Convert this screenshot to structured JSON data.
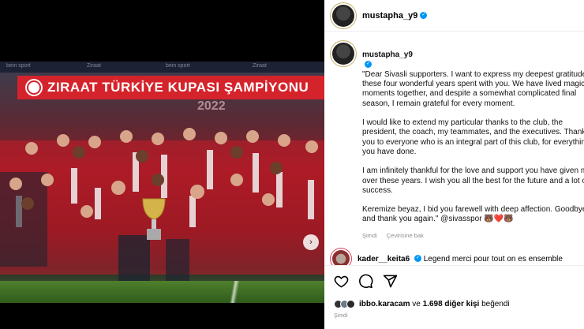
{
  "post": {
    "username": "mustapha_y9",
    "banner_text": "ZIRAAT TÜRKİYE KUPASI ŞAMPİYONU",
    "banner_year": "2022",
    "ad_strip": [
      "bein sport",
      "Ziraat",
      "bein sport",
      "Ziraat"
    ],
    "caption_paragraphs": [
      "\"Dear Sivasli supporters. I want to express my deepest gratitude for these four wonderful years spent with you. We have lived magical moments together, and despite a somewhat complicated final season, I remain grateful for every moment.",
      "I would like to extend my particular thanks to the club, the president, the coach, my teammates, and the executives. Thank you to everyone who is an integral part of this club, for everything you have done.",
      "I am infinitely thankful for the love and support you have given me over these years. I wish you all the best for the future and a lot of success.",
      "Keremize beyaz, I bid you farewell with deep affection. Goodbye and thank you again.\" @sivasspor 🐻❤️🐻"
    ],
    "caption_time": "Şimdi",
    "translate_label": "Çevirisine bak"
  },
  "comment": {
    "username": "kader__keita6",
    "text": "Legend merci pour tout on es ensemble"
  },
  "likes": {
    "user": "ibbo.karacam",
    "connector": "ve",
    "others": "1.698 diğer kişi",
    "suffix": "beğendi",
    "time": "Şimdi"
  },
  "icons": [
    "heart-icon",
    "comment-icon",
    "share-icon",
    "next-arrow-icon",
    "verified-icon"
  ],
  "colors": {
    "accent": "#0095f6",
    "banner": "#d5232b",
    "muted": "#8e8e8e"
  }
}
